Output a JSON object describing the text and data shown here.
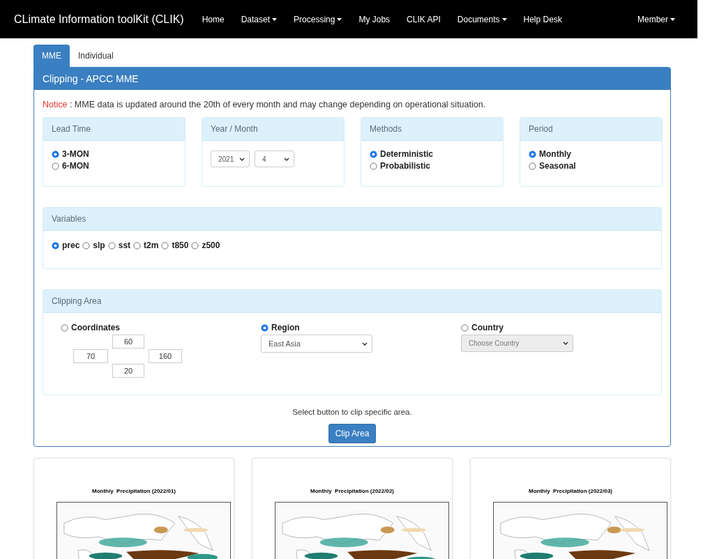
{
  "navbar": {
    "brand": "CLimate Information toolKit (CLIK)",
    "items": [
      {
        "label": "Home",
        "dropdown": false
      },
      {
        "label": "Dataset",
        "dropdown": true
      },
      {
        "label": "Processing",
        "dropdown": true
      },
      {
        "label": "My Jobs",
        "dropdown": false
      },
      {
        "label": "CLIK API",
        "dropdown": false
      },
      {
        "label": "Documents",
        "dropdown": true
      },
      {
        "label": "Help Desk",
        "dropdown": false
      }
    ],
    "member": {
      "label": "Member",
      "dropdown": true
    }
  },
  "tabs": [
    {
      "label": "MME",
      "selected": true
    },
    {
      "label": "Individual",
      "selected": false
    }
  ],
  "panel": {
    "title": "Clipping - APCC MME",
    "notice": {
      "label": "Notice",
      "text": " : MME data is updated around the 20th of every month and may change depending on operational situation."
    },
    "lead_time": {
      "title": "Lead Time",
      "options": [
        {
          "label": "3-MON",
          "selected": true
        },
        {
          "label": "6-MON",
          "selected": false
        }
      ]
    },
    "year_month": {
      "title": "Year / Month",
      "year": "2021",
      "month": "4"
    },
    "methods": {
      "title": "Methods",
      "options": [
        {
          "label": "Deterministic",
          "selected": true
        },
        {
          "label": "Probabilistic",
          "selected": false
        }
      ]
    },
    "period": {
      "title": "Period",
      "options": [
        {
          "label": "Monthly",
          "selected": true
        },
        {
          "label": "Seasonal",
          "selected": false
        }
      ]
    },
    "variables": {
      "title": "Variables",
      "options": [
        {
          "label": "prec",
          "selected": true
        },
        {
          "label": "slp",
          "selected": false
        },
        {
          "label": "sst",
          "selected": false
        },
        {
          "label": "t2m",
          "selected": false
        },
        {
          "label": "t850",
          "selected": false
        },
        {
          "label": "z500",
          "selected": false
        }
      ]
    },
    "clipping_area": {
      "title": "Clipping Area",
      "coordinates": {
        "label": "Coordinates",
        "selected": false,
        "north": "60",
        "west": "70",
        "east": "160",
        "south": "20"
      },
      "region": {
        "label": "Region",
        "selected": true,
        "value": "East Asia"
      },
      "country": {
        "label": "Country",
        "selected": false,
        "placeholder": "Choose Country",
        "disabled": true
      }
    },
    "hint": "Select button to clip specific area.",
    "clip_button": "Clip Area"
  },
  "maps": [
    {
      "title": "Monthly  Precipitation (2022/01)"
    },
    {
      "title": "Monthly  Precipitation (2022/02)"
    },
    {
      "title": "Monthly  Precipitation (2022/03)"
    }
  ]
}
